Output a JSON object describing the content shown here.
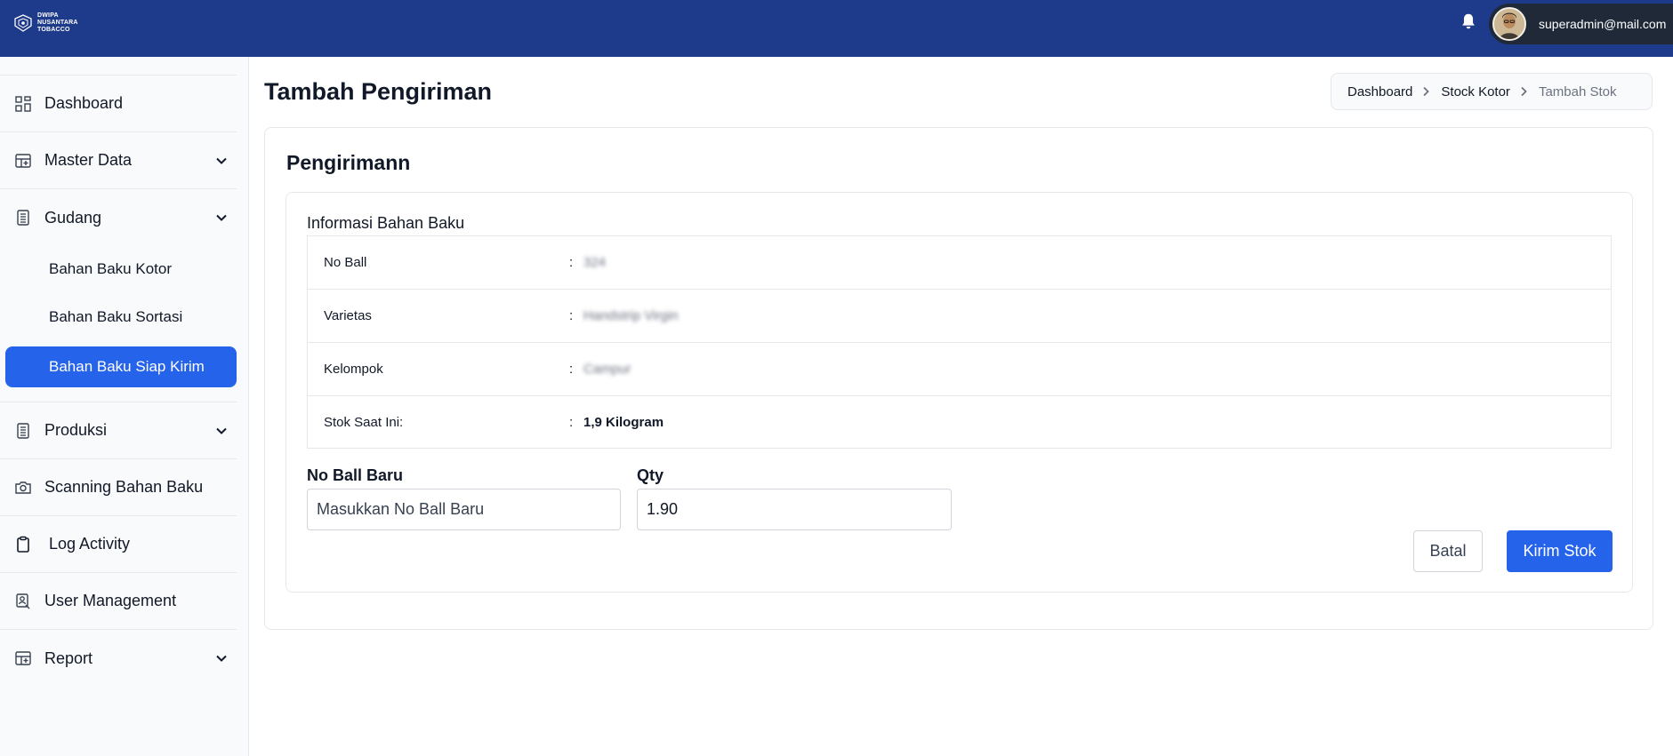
{
  "header": {
    "logo_lines": [
      "DWIPA",
      "NUSANTARA",
      "TOBACCO"
    ],
    "user_email": "superadmin@mail.com",
    "bell_icon": "bell-icon"
  },
  "sidebar": {
    "items": [
      {
        "label": "Dashboard",
        "icon": "dashboard-grid-icon"
      },
      {
        "label": "Master Data",
        "icon": "table-plus-icon"
      },
      {
        "label": "Gudang",
        "icon": "clipboard-list-icon"
      },
      {
        "label": "Produksi",
        "icon": "clipboard-list-icon"
      },
      {
        "label": "Scanning Bahan Baku",
        "icon": "camera-icon"
      },
      {
        "label": "Log Activity",
        "icon": "clipboard-icon"
      },
      {
        "label": "User Management",
        "icon": "user-badge-icon"
      },
      {
        "label": "Report",
        "icon": "table-plus-icon"
      }
    ],
    "gudang_sub": [
      {
        "label": "Bahan Baku Kotor"
      },
      {
        "label": "Bahan Baku Sortasi"
      },
      {
        "label": "Bahan Baku Siap Kirim"
      }
    ],
    "active_sub": "Bahan Baku Siap Kirim"
  },
  "page": {
    "title": "Tambah Pengiriman",
    "breadcrumb": [
      "Dashboard",
      "Stock Kotor",
      "Tambah Stok"
    ]
  },
  "card": {
    "title": "Pengirimann",
    "section_title": "Informasi Bahan Baku",
    "info": [
      {
        "key": "No Ball",
        "value": "324"
      },
      {
        "key": "Varietas",
        "value": "Handstrip Virgin"
      },
      {
        "key": "Kelompok",
        "value": "Campur"
      },
      {
        "key": "Stok Saat Ini:",
        "value": "1,9 Kilogram"
      }
    ],
    "colon": ":"
  },
  "form": {
    "no_ball_label": "No Ball Baru",
    "no_ball_placeholder": "Masukkan No Ball Baru",
    "qty_label": "Qty",
    "qty_value": "1.90",
    "cancel_label": "Batal",
    "submit_label": "Kirim Stok"
  },
  "colors": {
    "topbar": "#1e3a8a",
    "accent": "#2563eb"
  }
}
